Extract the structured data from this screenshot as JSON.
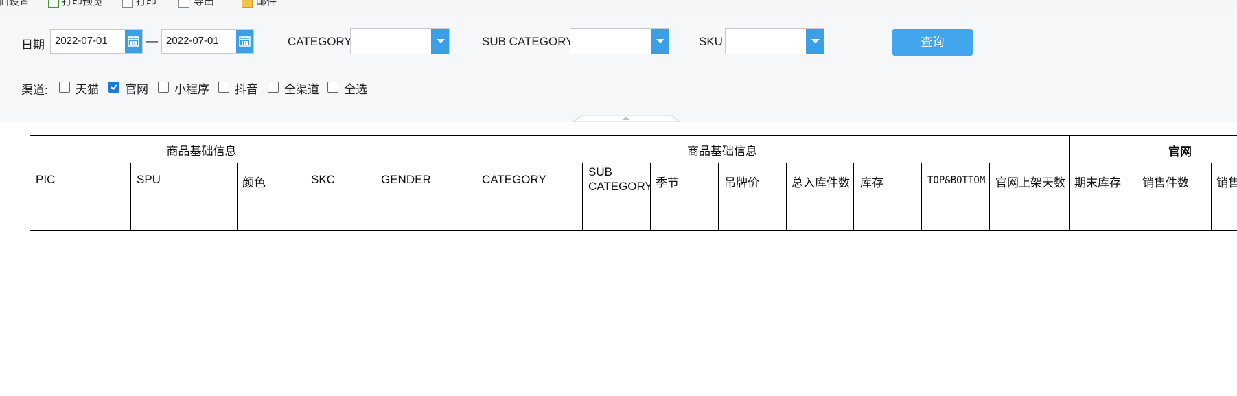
{
  "toolbar": {
    "items": [
      "面设置",
      "打印预览",
      "打印",
      "导出",
      "邮件"
    ]
  },
  "filters": {
    "date_label": "日期",
    "date_from": "2022-07-01",
    "date_sep": "—",
    "date_to": "2022-07-01",
    "category_label": "CATEGORY",
    "category_value": "",
    "sub_category_label": "SUB CATEGORY",
    "sub_category_value": "",
    "sku_label": "SKU",
    "sku_value": "",
    "query_button": "查询",
    "channel_label": "渠道:",
    "channels": [
      {
        "label": "天猫",
        "checked": false
      },
      {
        "label": "官网",
        "checked": true
      },
      {
        "label": "小程序",
        "checked": false
      },
      {
        "label": "抖音",
        "checked": false
      },
      {
        "label": "全渠道",
        "checked": false
      },
      {
        "label": "全选",
        "checked": false
      }
    ]
  },
  "colors": {
    "accent": "#3b9fe6",
    "button": "#42a6ee",
    "checkbox_checked": "#1e78d7",
    "panel_bg": "#f6f7f9"
  },
  "table": {
    "group_headers": [
      "商品基础信息",
      "商品基础信息",
      "官网"
    ],
    "columns": [
      "PIC",
      "SPU",
      "颜色",
      "SKC",
      "GENDER",
      "CATEGORY",
      "SUB CATEGORY",
      "季节",
      "吊牌价",
      "总入库件数",
      "库存",
      "TOP&BOTTOM",
      "官网上架天数",
      "期末库存",
      "销售件数",
      "销售"
    ],
    "sub_category_line1": "SUB",
    "sub_category_line2": "CATEGORY"
  }
}
